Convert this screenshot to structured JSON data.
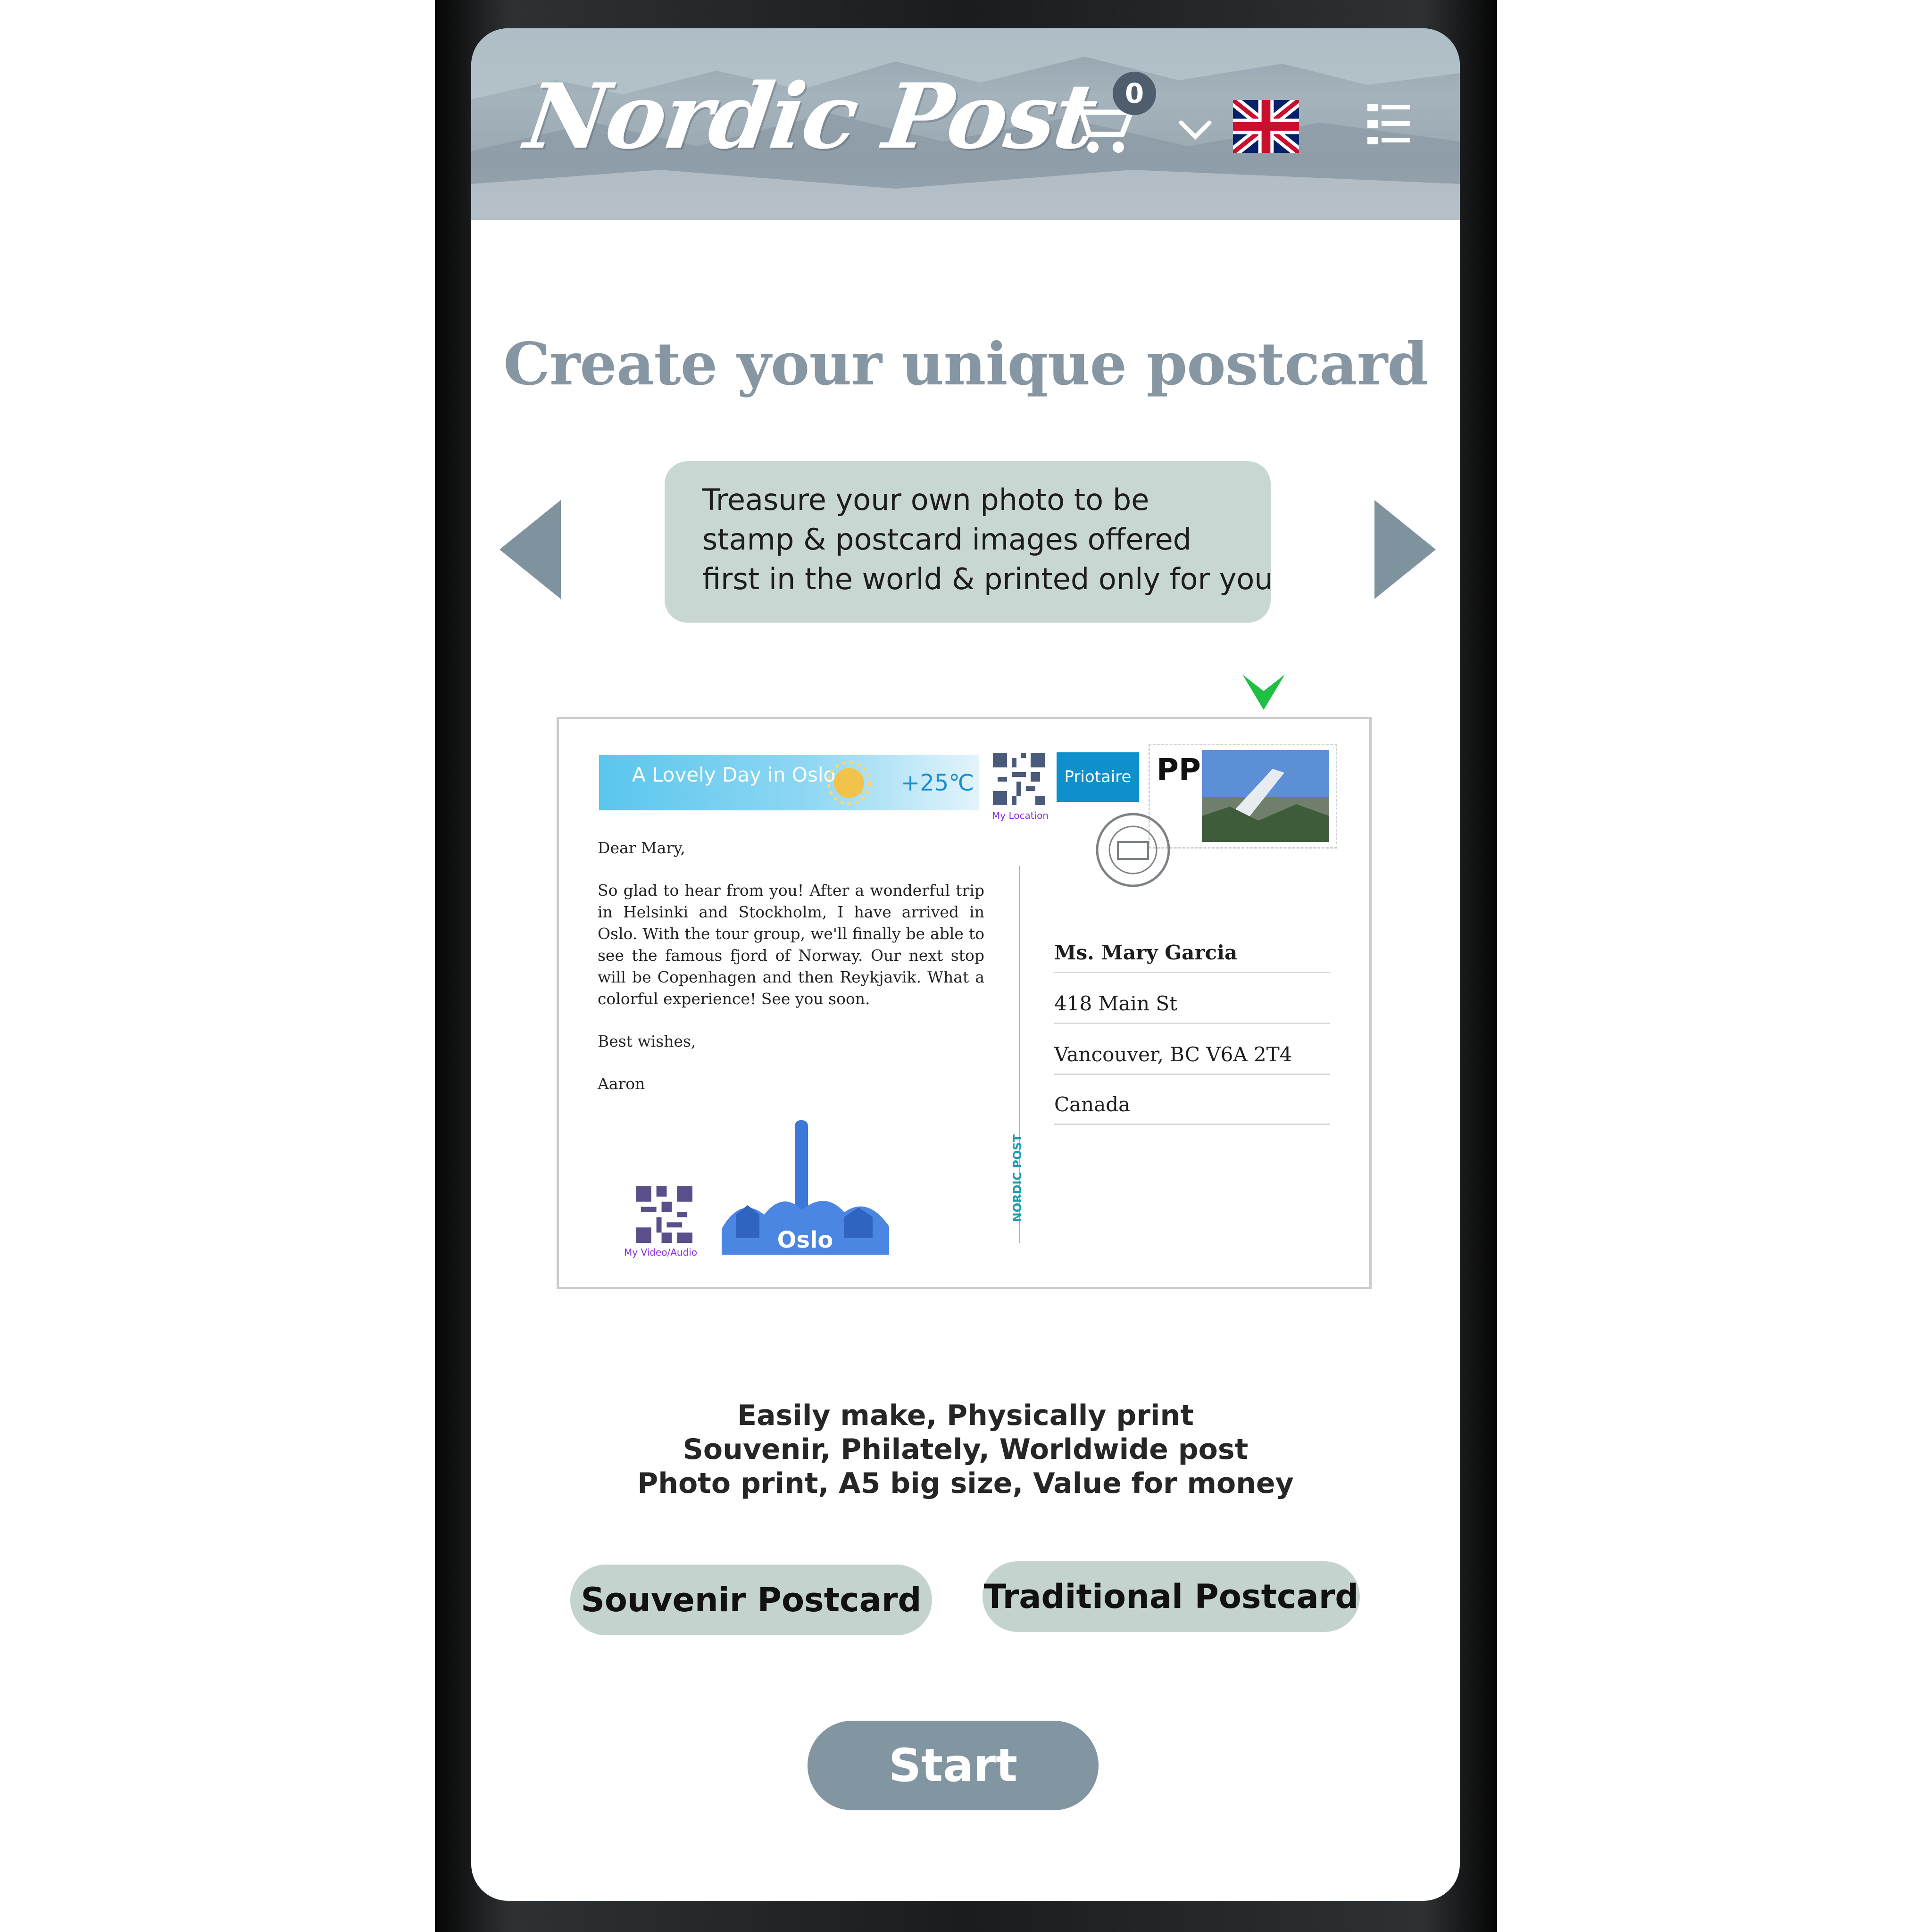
{
  "header": {
    "logo_text": "Nordic Post",
    "cart_count": "0"
  },
  "page": {
    "title": "Create your unique postcard"
  },
  "carousel": {
    "lines": [
      "Treasure your own photo to be",
      "stamp & postcard images offered",
      "first in the world & printed only for you"
    ]
  },
  "postcard": {
    "banner_title": "A Lovely Day in Oslo",
    "temperature": "+25℃",
    "priority_label": "Priotaire",
    "stamp_label": "PP",
    "letter": {
      "greeting": "Dear Mary,",
      "body": "So glad to hear from you! After a wonderful trip in Helsinki and Stockholm, I have arrived in Oslo. With the tour group, we'll finally be able to see the famous fjord of Norway. Our next stop will be Copenhagen and then Reykjavik. What a colorful experience! See you soon.",
      "closing": "Best wishes,",
      "signature": "Aaron"
    },
    "address": {
      "name": "Ms. Mary Garcia",
      "street": "418 Main St",
      "city": "Vancouver, BC V6A 2T4",
      "country": "Canada"
    },
    "location_label": "My Location",
    "video_label": "My Video/Audio",
    "brand_vertical": "NORDIC POST",
    "city_label": "Oslo"
  },
  "features": [
    "Easily make, Physically print",
    "Souvenir, Philately, Worldwide post",
    "Photo print, A5 big size, Value for money"
  ],
  "buttons": {
    "souvenir": "Souvenir Postcard",
    "traditional": "Traditional Postcard",
    "start": "Start"
  },
  "colors": {
    "accent": "#8296a2",
    "pill": "#c5d3cf",
    "bubble": "#c9d7d3",
    "title": "#8696a2"
  }
}
